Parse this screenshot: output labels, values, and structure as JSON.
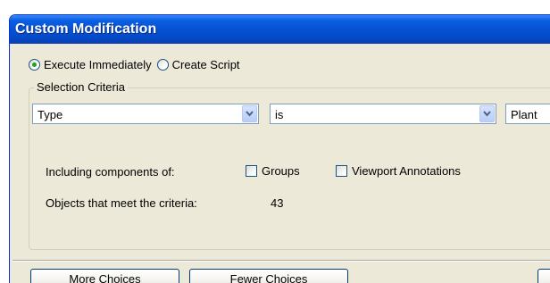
{
  "window": {
    "title": "Custom Modification"
  },
  "mode": {
    "options": [
      {
        "label": "Execute Immediately",
        "checked": true
      },
      {
        "label": "Create Script",
        "checked": false
      }
    ]
  },
  "criteria": {
    "group_label": "Selection Criteria",
    "field_value": "Type",
    "operator_value": "is",
    "value_text": "Plant",
    "including_label": "Including components of:",
    "checkboxes": [
      {
        "label": "Groups",
        "checked": false
      },
      {
        "label": "Viewport Annotations",
        "checked": false
      }
    ],
    "count_label": "Objects that meet the criteria:",
    "count_value": "43"
  },
  "buttons": {
    "more": "More Choices",
    "fewer": "Fewer Choices"
  },
  "icons": {
    "dropdown": "chevron-down-icon"
  },
  "colors": {
    "titlebar": "#0552d4",
    "face": "#ece9d8",
    "radio_checked": "#21a121"
  }
}
